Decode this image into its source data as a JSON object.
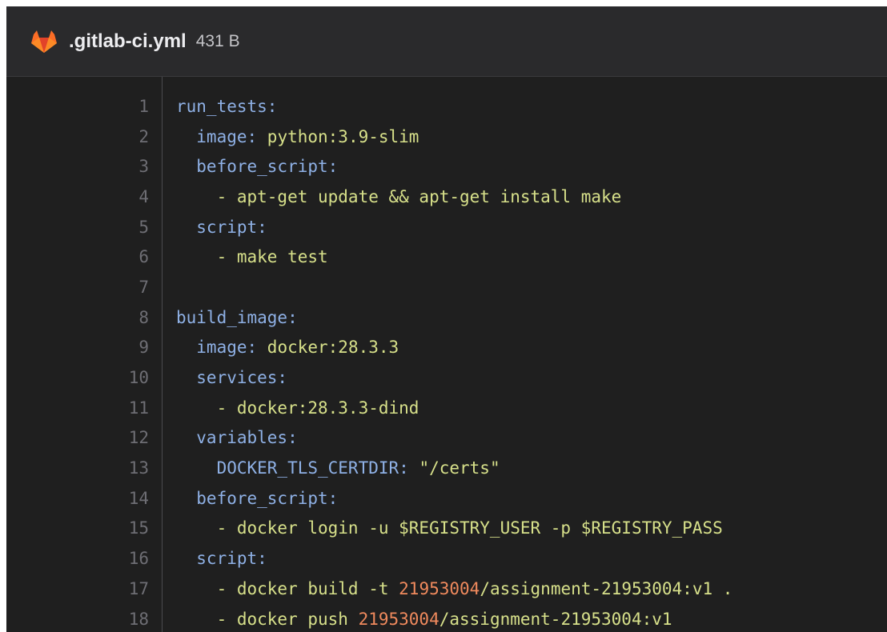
{
  "file": {
    "name": ".gitlab-ci.yml",
    "size": "431 B"
  },
  "colors": {
    "key": "#8fb1e6",
    "string": "#d7e08a",
    "number": "#f08a5d",
    "line_number": "#6e6e74",
    "background": "#1f1f1f"
  },
  "lines": [
    {
      "no": "1",
      "parts": [
        {
          "t": "run_tests:",
          "c": "k"
        }
      ]
    },
    {
      "no": "2",
      "parts": [
        {
          "t": "  image: ",
          "c": "k"
        },
        {
          "t": "python:3.9-slim",
          "c": "s"
        }
      ]
    },
    {
      "no": "3",
      "parts": [
        {
          "t": "  before_script:",
          "c": "k"
        }
      ]
    },
    {
      "no": "4",
      "parts": [
        {
          "t": "    - apt-get update && apt-get install make",
          "c": "s"
        }
      ]
    },
    {
      "no": "5",
      "parts": [
        {
          "t": "  script:",
          "c": "k"
        }
      ]
    },
    {
      "no": "6",
      "parts": [
        {
          "t": "    - make test",
          "c": "s"
        }
      ]
    },
    {
      "no": "7",
      "parts": [
        {
          "t": "",
          "c": "s"
        }
      ]
    },
    {
      "no": "8",
      "parts": [
        {
          "t": "build_image:",
          "c": "k"
        }
      ]
    },
    {
      "no": "9",
      "parts": [
        {
          "t": "  image: ",
          "c": "k"
        },
        {
          "t": "docker:28.3.3",
          "c": "s"
        }
      ]
    },
    {
      "no": "10",
      "parts": [
        {
          "t": "  services:",
          "c": "k"
        }
      ]
    },
    {
      "no": "11",
      "parts": [
        {
          "t": "    - docker:28.3.3-dind",
          "c": "s"
        }
      ]
    },
    {
      "no": "12",
      "parts": [
        {
          "t": "  variables:",
          "c": "k"
        }
      ]
    },
    {
      "no": "13",
      "parts": [
        {
          "t": "    DOCKER_TLS_CERTDIR: ",
          "c": "k"
        },
        {
          "t": "\"/certs\"",
          "c": "s"
        }
      ]
    },
    {
      "no": "14",
      "parts": [
        {
          "t": "  before_script:",
          "c": "k"
        }
      ]
    },
    {
      "no": "15",
      "parts": [
        {
          "t": "    - docker login -u $REGISTRY_USER -p $REGISTRY_PASS",
          "c": "s"
        }
      ]
    },
    {
      "no": "16",
      "parts": [
        {
          "t": "  script:",
          "c": "k"
        }
      ]
    },
    {
      "no": "17",
      "parts": [
        {
          "t": "    - docker build -t ",
          "c": "s"
        },
        {
          "t": "21953004",
          "c": "n"
        },
        {
          "t": "/assignment-21953004:v1 .",
          "c": "s"
        }
      ]
    },
    {
      "no": "18",
      "parts": [
        {
          "t": "    - docker push ",
          "c": "s"
        },
        {
          "t": "21953004",
          "c": "n"
        },
        {
          "t": "/assignment-21953004:v1",
          "c": "s"
        }
      ]
    }
  ]
}
